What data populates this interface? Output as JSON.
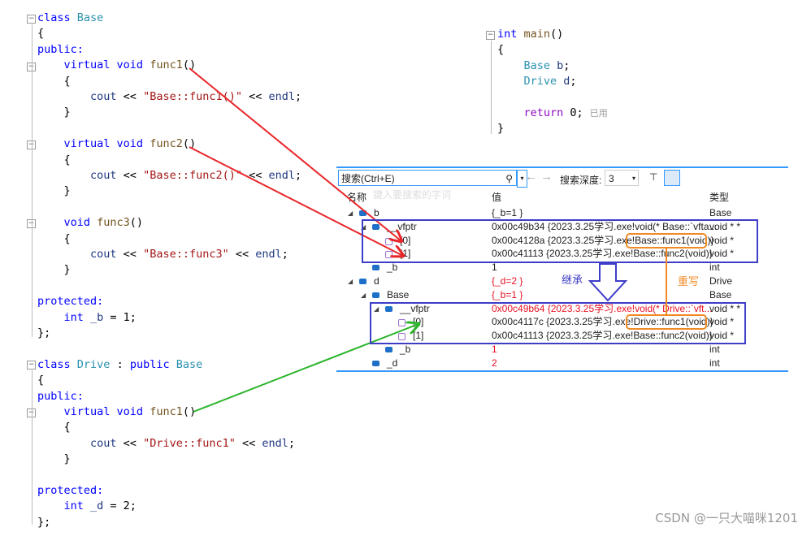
{
  "code_left": [
    [
      [
        "class ",
        "kw"
      ],
      [
        "Base",
        "ty"
      ]
    ],
    [
      [
        "{",
        "pl"
      ]
    ],
    [
      [
        "public:",
        "kw"
      ]
    ],
    [
      [
        "    virtual ",
        "kw"
      ],
      [
        "void ",
        "kw"
      ],
      [
        "func1",
        "fn"
      ],
      [
        "()",
        "pl"
      ]
    ],
    [
      [
        "    {",
        "pl"
      ]
    ],
    [
      [
        "        cout ",
        "id"
      ],
      [
        "<< ",
        "pl"
      ],
      [
        "\"Base::func1()\" ",
        "st"
      ],
      [
        "<< ",
        "pl"
      ],
      [
        "endl",
        "id"
      ],
      [
        ";",
        "pl"
      ]
    ],
    [
      [
        "    }",
        "pl"
      ]
    ],
    [
      [
        "",
        ""
      ]
    ],
    [
      [
        "    virtual ",
        "kw"
      ],
      [
        "void ",
        "kw"
      ],
      [
        "func2",
        "fn"
      ],
      [
        "()",
        "pl"
      ]
    ],
    [
      [
        "    {",
        "pl"
      ]
    ],
    [
      [
        "        cout ",
        "id"
      ],
      [
        "<< ",
        "pl"
      ],
      [
        "\"Base::func2()\" ",
        "st"
      ],
      [
        "<< ",
        "pl"
      ],
      [
        "endl",
        "id"
      ],
      [
        ";",
        "pl"
      ]
    ],
    [
      [
        "    }",
        "pl"
      ]
    ],
    [
      [
        "",
        ""
      ]
    ],
    [
      [
        "    void ",
        "kw"
      ],
      [
        "func3",
        "fn"
      ],
      [
        "()",
        "pl"
      ]
    ],
    [
      [
        "    {",
        "pl"
      ]
    ],
    [
      [
        "        cout ",
        "id"
      ],
      [
        "<< ",
        "pl"
      ],
      [
        "\"Base::func3\" ",
        "st"
      ],
      [
        "<< ",
        "pl"
      ],
      [
        "endl",
        "id"
      ],
      [
        ";",
        "pl"
      ]
    ],
    [
      [
        "    }",
        "pl"
      ]
    ],
    [
      [
        "",
        ""
      ]
    ],
    [
      [
        "protected:",
        "kw"
      ]
    ],
    [
      [
        "    int ",
        "kw"
      ],
      [
        "_b ",
        "id"
      ],
      [
        "= 1;",
        "pl"
      ]
    ],
    [
      [
        "};",
        "pl"
      ]
    ],
    [
      [
        "",
        ""
      ]
    ],
    [
      [
        "class ",
        "kw"
      ],
      [
        "Drive ",
        "ty"
      ],
      [
        ": ",
        "pl"
      ],
      [
        "public ",
        "kw"
      ],
      [
        "Base",
        "ty"
      ]
    ],
    [
      [
        "{",
        "pl"
      ]
    ],
    [
      [
        "public:",
        "kw"
      ]
    ],
    [
      [
        "    virtual ",
        "kw"
      ],
      [
        "void ",
        "kw"
      ],
      [
        "func1",
        "fn"
      ],
      [
        "()",
        "pl"
      ]
    ],
    [
      [
        "    {",
        "pl"
      ]
    ],
    [
      [
        "        cout ",
        "id"
      ],
      [
        "<< ",
        "pl"
      ],
      [
        "\"Drive::func1\" ",
        "st"
      ],
      [
        "<< ",
        "pl"
      ],
      [
        "endl",
        "id"
      ],
      [
        ";",
        "pl"
      ]
    ],
    [
      [
        "    }",
        "pl"
      ]
    ],
    [
      [
        "",
        ""
      ]
    ],
    [
      [
        "protected:",
        "kw"
      ]
    ],
    [
      [
        "    int ",
        "kw"
      ],
      [
        "_d ",
        "id"
      ],
      [
        "= 2;",
        "pl"
      ]
    ],
    [
      [
        "};",
        "pl"
      ]
    ]
  ],
  "code_main": [
    [
      [
        "int ",
        "kw"
      ],
      [
        "main",
        "fn"
      ],
      [
        "()",
        "pl"
      ]
    ],
    [
      [
        "{",
        "pl"
      ]
    ],
    [
      [
        "    Base ",
        "ty"
      ],
      [
        "b",
        "id"
      ],
      [
        ";",
        "pl"
      ]
    ],
    [
      [
        "    Drive ",
        "ty"
      ],
      [
        "d",
        "id"
      ],
      [
        ";",
        "pl"
      ]
    ],
    [
      [
        "",
        ""
      ]
    ],
    [
      [
        "    return ",
        "rt"
      ],
      [
        "0; ",
        "pl"
      ],
      [
        "已用",
        "hint"
      ]
    ],
    [
      [
        "}",
        "pl"
      ]
    ]
  ],
  "watch": {
    "search_label": "搜索(Ctrl+E)",
    "search_placeholder": "键入要搜索的字词",
    "depth_label": "搜索深度:",
    "depth_value": "3",
    "headers": {
      "name": "名称",
      "value": "值",
      "type": "类型"
    },
    "rows": [
      {
        "name": "b",
        "value": "{_b=1 }",
        "type": "Base",
        "indent": 0,
        "expand": true,
        "red": false
      },
      {
        "name": "__vfptr",
        "value": "0x00c49b34 {2023.3.25学习.exe!void(* Base::`vfta...",
        "type": "void * *",
        "indent": 1,
        "expand": true,
        "red": false
      },
      {
        "name": "[0]",
        "value": "0x00c4128a {2023.3.25学习.exe!Base::func1(void)}",
        "type": "void *",
        "indent": 2,
        "expand": false,
        "red": false
      },
      {
        "name": "[1]",
        "value": "0x00c41113 {2023.3.25学习.exe!Base::func2(void)}",
        "type": "void *",
        "indent": 2,
        "expand": false,
        "red": false
      },
      {
        "name": "_b",
        "value": "1",
        "type": "int",
        "indent": 1,
        "expand": false,
        "red": false
      },
      {
        "name": "d",
        "value": "{_d=2 }",
        "type": "Drive",
        "indent": 0,
        "expand": true,
        "red": true
      },
      {
        "name": "Base",
        "value": "{_b=1 }",
        "type": "Base",
        "indent": 1,
        "expand": true,
        "red": true
      },
      {
        "name": "__vfptr",
        "value": "0x00c49b64 {2023.3.25学习.exe!void(* Drive::`vft...",
        "type": "void * *",
        "indent": 2,
        "expand": true,
        "red": true
      },
      {
        "name": "[0]",
        "value": "0x00c4117c {2023.3.25学习.exe!Drive::func1(void)}",
        "type": "void *",
        "indent": 3,
        "expand": false,
        "red": false
      },
      {
        "name": "[1]",
        "value": "0x00c41113 {2023.3.25学习.exe!Base::func2(void)}",
        "type": "void *",
        "indent": 3,
        "expand": false,
        "red": false
      },
      {
        "name": "_b",
        "value": "1",
        "type": "int",
        "indent": 2,
        "expand": false,
        "red": true
      },
      {
        "name": "_d",
        "value": "2",
        "type": "int",
        "indent": 1,
        "expand": false,
        "red": true
      }
    ]
  },
  "annotations": {
    "inherit": "继承",
    "override": "重写",
    "colors": {
      "red": "#e8262a",
      "green": "#2db52d",
      "blue": "#3d3dc8",
      "orange": "#f08a24"
    }
  },
  "watermark": "CSDN @一只大喵咪1201"
}
